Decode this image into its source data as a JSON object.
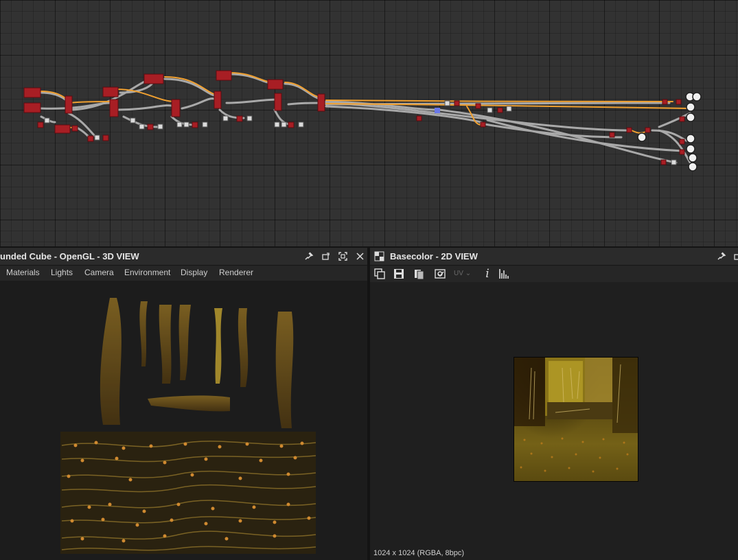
{
  "graph_panel": {
    "name": "node-graph"
  },
  "view3d": {
    "title": "unded Cube - OpenGL - 3D VIEW",
    "menu": [
      "Materials",
      "Lights",
      "Camera",
      "Environment",
      "Display",
      "Renderer"
    ],
    "icons": [
      "pin-icon",
      "float-window-icon",
      "maximize-icon",
      "close-icon"
    ]
  },
  "view2d": {
    "title": "Basecolor - 2D VIEW",
    "icons": [
      "pin-icon",
      "float-window-icon"
    ],
    "toolbar": {
      "uv_label": "UV"
    },
    "status": "1024 x 1024 (RGBA, 8bpc)"
  },
  "colors": {
    "accent_orange": "#f0a030",
    "node_red": "#a81e24",
    "wire_gray": "#a8a8a8",
    "panel_bg": "#1e1e1e"
  }
}
